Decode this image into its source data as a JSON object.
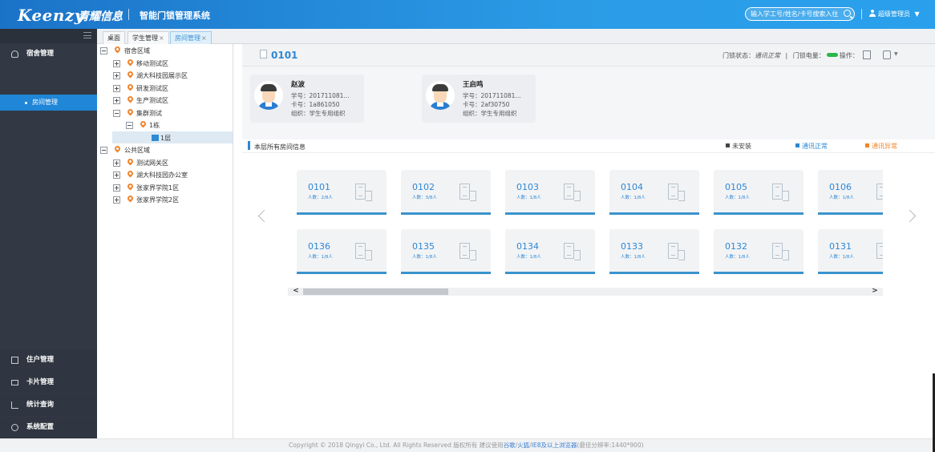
{
  "header": {
    "logo": "Keenzy",
    "logo_cn": "青耀信息",
    "app_title": "智能门锁管理系统",
    "search_placeholder": "输入学工号/姓名/卡号搜索入住",
    "user": "超级管理员",
    "user_caret": "▼",
    "brand_color": "#1f86d8"
  },
  "sidebar": {
    "top_items": [
      {
        "label": "宿舍管理",
        "icon": "building-icon"
      }
    ],
    "sub_items": [
      {
        "label": "房间管理",
        "active": true
      }
    ],
    "bottom_items": [
      {
        "label": "住户管理",
        "icon": "resident-icon"
      },
      {
        "label": "卡片管理",
        "icon": "card-icon"
      },
      {
        "label": "统计查询",
        "icon": "chart-icon"
      },
      {
        "label": "系统配置",
        "icon": "gear-icon"
      }
    ]
  },
  "tabs": [
    {
      "label": "桌面",
      "closable": false
    },
    {
      "label": "学生管理",
      "closable": true
    },
    {
      "label": "房间管理",
      "closable": true,
      "active": true
    }
  ],
  "tab_close": "×",
  "tree": {
    "nodes": [
      {
        "label": "宿舍区域",
        "toggle": "minus",
        "pin": true
      },
      {
        "label": "移动测试区",
        "toggle": "plus",
        "pin": true
      },
      {
        "label": "湖大科技园展示区",
        "toggle": "plus",
        "pin": true
      },
      {
        "label": "研发测试区",
        "toggle": "plus",
        "pin": true
      },
      {
        "label": "生产测试区",
        "toggle": "plus",
        "pin": true
      },
      {
        "label": "集群测试",
        "toggle": "minus",
        "pin": true
      },
      {
        "label": "1栋",
        "toggle": "minus",
        "pin": true
      },
      {
        "label": "1层",
        "selected": true
      },
      {
        "label": "公共区域",
        "toggle": "minus",
        "pin": true
      },
      {
        "label": "测试网关区",
        "toggle": "plus",
        "pin": true
      },
      {
        "label": "湖大科技园办公室",
        "toggle": "plus",
        "pin": true
      },
      {
        "label": "张家界学院1区",
        "toggle": "plus",
        "pin": true
      },
      {
        "label": "张家界学院2区",
        "toggle": "plus",
        "pin": true
      }
    ]
  },
  "room_header": {
    "room_no": "0101",
    "lock_status_label": "门锁状态：",
    "lock_status_value": "通讯正常",
    "battery_label": "门锁电量：",
    "operation_label": "操作：",
    "battery_color": "#2ab74a"
  },
  "tenants": [
    {
      "name": "赵波",
      "student_no": "学号：201711081...",
      "card_no": "卡号：1a861050",
      "org": "组织：学生专用组织"
    },
    {
      "name": "王启鸣",
      "student_no": "学号：201711081...",
      "card_no": "卡号：2af30750",
      "org": "组织：学生专用组织"
    }
  ],
  "rooms_section": {
    "title": "本层所有房间信息",
    "legend": [
      {
        "label": "未安装",
        "color": "#444444"
      },
      {
        "label": "通讯正常",
        "color": "#2d88d4"
      },
      {
        "label": "通讯异常",
        "color": "#f0842c"
      }
    ]
  },
  "rooms": [
    {
      "no": "0101",
      "count": "人数：2/8人"
    },
    {
      "no": "0102",
      "count": "人数：3/8人"
    },
    {
      "no": "0103",
      "count": "人数：1/8人"
    },
    {
      "no": "0104",
      "count": "人数：1/8人"
    },
    {
      "no": "0105",
      "count": "人数：1/8人"
    },
    {
      "no": "0106",
      "count": "人数：1/8人"
    },
    {
      "no": "0136",
      "count": "人数：1/8人"
    },
    {
      "no": "0135",
      "count": "人数：1/8人"
    },
    {
      "no": "0134",
      "count": "人数：1/8人"
    },
    {
      "no": "0133",
      "count": "人数：1/8人"
    },
    {
      "no": "0132",
      "count": "人数：1/8人"
    },
    {
      "no": "0131",
      "count": "人数：1/8人"
    }
  ],
  "scroll": {
    "left": "<",
    "right": ">"
  },
  "footer": {
    "text1": "Copyright © 2018 Qingyi Co., Ltd. All Rights Reserved 版权所有  建议使用",
    "link1": "谷歌",
    "text2": "/",
    "link2": "火狐",
    "text3": "/",
    "link3": "IE8及以上浏览器",
    "text4": "(最佳分辨率:1440*900)"
  }
}
